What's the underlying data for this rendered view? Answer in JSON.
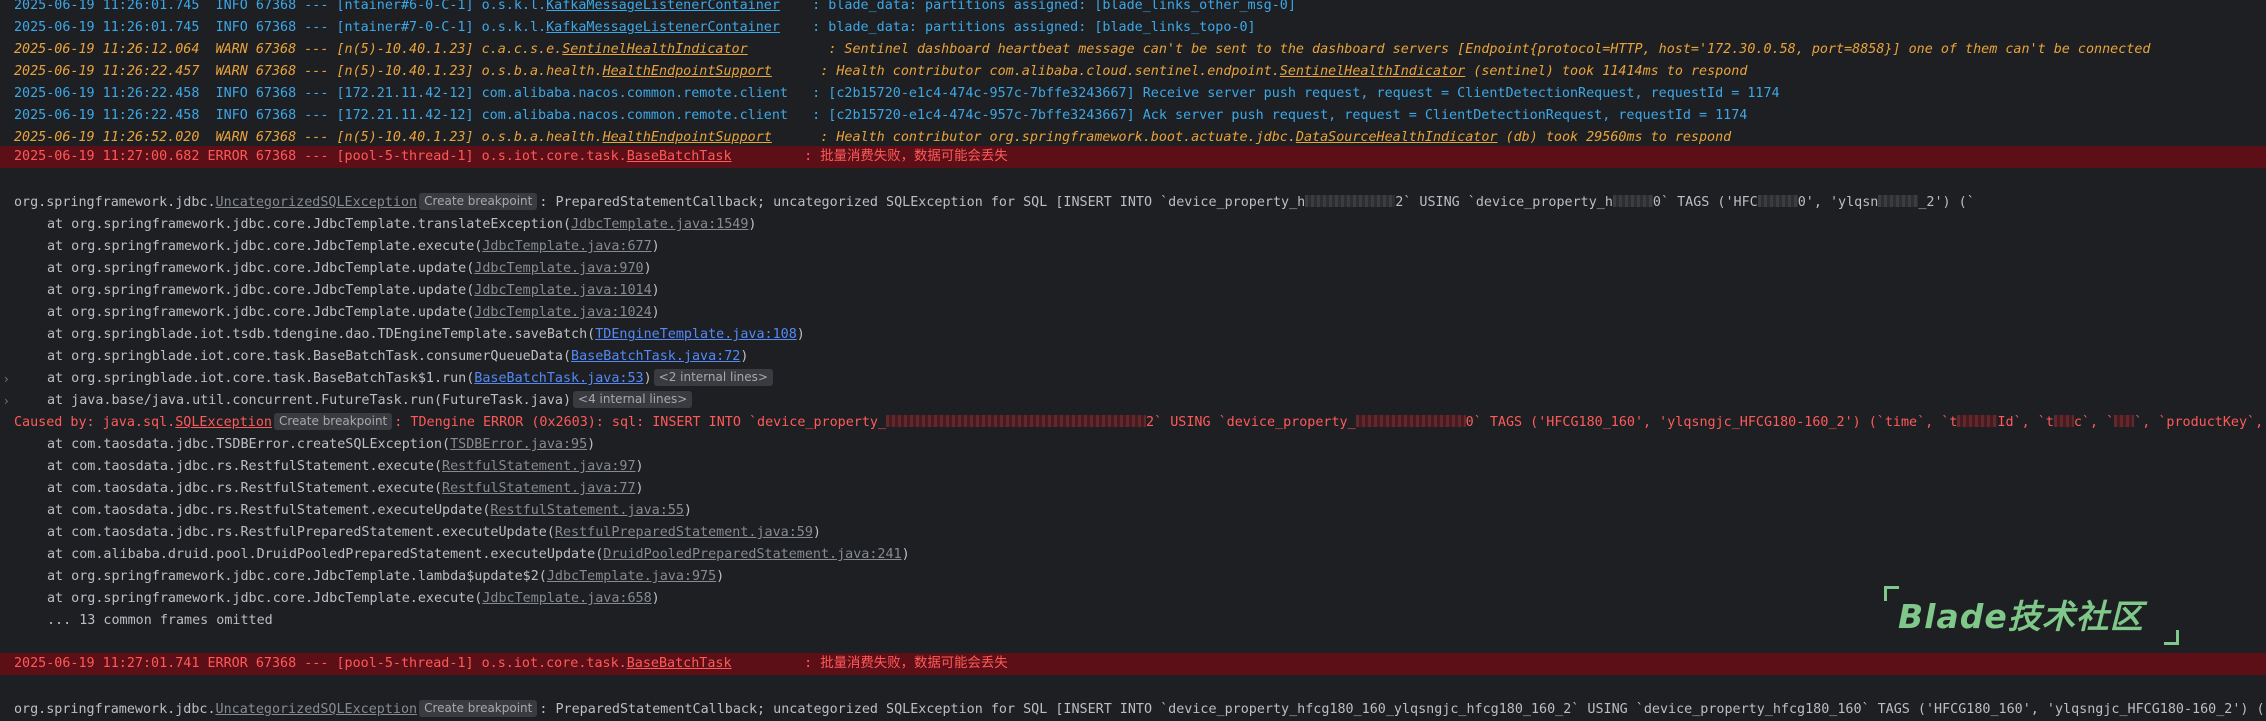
{
  "colors": {
    "background": "#1e1f22",
    "info": "#3ca8e8",
    "warn": "#e8a33c",
    "error": "#ff5a5a",
    "error_row_bg": "#5c0f16",
    "link": "#548af7",
    "watermark": "#7fc88a"
  },
  "console": {
    "chip_breakpoint": "Create breakpoint",
    "log_lines": [
      {
        "ts": "2025-06-19 11:26:01.745",
        "level": "INFO",
        "pid": "67368",
        "sep": "---",
        "thread": "[ntainer#6-0-C-1]",
        "logger_prefix": "o.s.k.l.",
        "logger_cls": "KafkaMessageListenerContainer",
        "pad": "    ",
        "msg": ": blade_data: partitions assigned: [blade_links_other_msg-0]"
      },
      {
        "ts": "2025-06-19 11:26:01.745",
        "level": "INFO",
        "pid": "67368",
        "sep": "---",
        "thread": "[ntainer#7-0-C-1]",
        "logger_prefix": "o.s.k.l.",
        "logger_cls": "KafkaMessageListenerContainer",
        "pad": "    ",
        "msg": ": blade_data: partitions assigned: [blade_links_topo-0]"
      },
      {
        "ts": "2025-06-19 11:26:12.064",
        "level": "WARN",
        "pid": "67368",
        "sep": "---",
        "thread": "[n(5)-10.40.1.23]",
        "logger_prefix": "c.a.c.s.e.",
        "logger_cls": "SentinelHealthIndicator",
        "pad": "          ",
        "msg": ": Sentinel dashboard heartbeat message can't be sent to the dashboard servers [Endpoint{protocol=HTTP, host='172.30.0.58, port=8858}] one of them can't be connected"
      },
      {
        "ts": "2025-06-19 11:26:22.457",
        "level": "WARN",
        "pid": "67368",
        "sep": "---",
        "thread": "[n(5)-10.40.1.23]",
        "logger_prefix": "o.s.b.a.health.",
        "logger_cls": "HealthEndpointSupport",
        "pad": "      ",
        "msg_pre": ": Health contributor com.alibaba.cloud.sentinel.endpoint.",
        "msg_cls": "SentinelHealthIndicator",
        "msg_post": " (sentinel) took 11414ms to respond"
      },
      {
        "ts": "2025-06-19 11:26:22.458",
        "level": "INFO",
        "pid": "67368",
        "sep": "---",
        "thread": "[172.21.11.42-12]",
        "logger_prefix": "com.alibaba.nacos.common.remote.client",
        "logger_cls": "",
        "pad": "   ",
        "msg": ": [c2b15720-e1c4-474c-957c-7bffe3243667] Receive server push request, request = ClientDetectionRequest, requestId = 1174"
      },
      {
        "ts": "2025-06-19 11:26:22.458",
        "level": "INFO",
        "pid": "67368",
        "sep": "---",
        "thread": "[172.21.11.42-12]",
        "logger_prefix": "com.alibaba.nacos.common.remote.client",
        "logger_cls": "",
        "pad": "   ",
        "msg": ": [c2b15720-e1c4-474c-957c-7bffe3243667] Ack server push request, request = ClientDetectionRequest, requestId = 1174"
      },
      {
        "ts": "2025-06-19 11:26:52.020",
        "level": "WARN",
        "pid": "67368",
        "sep": "---",
        "thread": "[n(5)-10.40.1.23]",
        "logger_prefix": "o.s.b.a.health.",
        "logger_cls": "HealthEndpointSupport",
        "pad": "      ",
        "msg_pre": ": Health contributor org.springframework.boot.actuate.jdbc.",
        "msg_cls": "DataSourceHealthIndicator",
        "msg_post": " (db) took 29560ms to respond"
      }
    ],
    "error_lines": [
      {
        "ts": "2025-06-19 11:27:00.682",
        "level": "ERROR",
        "pid": "67368",
        "sep": "---",
        "thread": "[pool-5-thread-1]",
        "logger_prefix": "o.s.iot.core.task.",
        "logger_cls": "BaseBatchTask",
        "pad": "         ",
        "msg": ": 批量消费失败，数据可能会丢失"
      },
      {
        "ts": "2025-06-19 11:27:01.741",
        "level": "ERROR",
        "pid": "67368",
        "sep": "---",
        "thread": "[pool-5-thread-1]",
        "logger_prefix": "o.s.iot.core.task.",
        "logger_cls": "BaseBatchTask",
        "pad": "         ",
        "msg": ": 批量消费失败，数据可能会丢失"
      }
    ],
    "exception1": {
      "pkg": "org.springframework.jdbc.",
      "cls": "UncategorizedSQLException",
      "msg_a": ": PreparedStatementCallback; uncategorized SQLException for SQL [INSERT INTO `device_property_h",
      "msg_b": "2` USING `device_property_h",
      "msg_c": "0` TAGS ('HFC",
      "msg_d": "0', 'ylqsn",
      "msg_e": "_2') (`"
    },
    "stack1": [
      {
        "pre": "at org.springframework.jdbc.core.JdbcTemplate.translateException(",
        "link": "JdbcTemplate.java:1549",
        "kind": "gray",
        "post": ")"
      },
      {
        "pre": "at org.springframework.jdbc.core.JdbcTemplate.execute(",
        "link": "JdbcTemplate.java:677",
        "kind": "gray",
        "post": ")"
      },
      {
        "pre": "at org.springframework.jdbc.core.JdbcTemplate.update(",
        "link": "JdbcTemplate.java:970",
        "kind": "gray",
        "post": ")"
      },
      {
        "pre": "at org.springframework.jdbc.core.JdbcTemplate.update(",
        "link": "JdbcTemplate.java:1014",
        "kind": "gray",
        "post": ")"
      },
      {
        "pre": "at org.springframework.jdbc.core.JdbcTemplate.update(",
        "link": "JdbcTemplate.java:1024",
        "kind": "gray",
        "post": ")"
      },
      {
        "pre": "at org.springblade.iot.tsdb.tdengine.dao.TDEngineTemplate.saveBatch(",
        "link": "TDEngineTemplate.java:108",
        "kind": "blue",
        "post": ")"
      },
      {
        "pre": "at org.springblade.iot.core.task.BaseBatchTask.consumerQueueData(",
        "link": "BaseBatchTask.java:72",
        "kind": "blue",
        "post": ")"
      },
      {
        "pre": "at org.springblade.iot.core.task.BaseBatchTask$1.run(",
        "link": "BaseBatchTask.java:53",
        "kind": "blue",
        "post": ")",
        "chip": "<2 internal lines>",
        "chev": true
      },
      {
        "pre": "at java.base/java.util.concurrent.FutureTask.run(FutureTask.java)",
        "link": "",
        "kind": "none",
        "post": "",
        "chip": "<4 internal lines>",
        "chev": true
      }
    ],
    "caused_by": {
      "pre": "Caused by: java.sql.",
      "cls": "SQLException",
      "msg_a": ": TDengine ERROR (0x2603): sql: INSERT INTO `device_property_",
      "msg_b": "2` USING `device_property_",
      "msg_c": "0` TAGS ('HFCG180_160', 'ylqsngjc_HFCG180-160_2') (`time`, `t",
      "msg_d": "Id`, `t",
      "msg_e": "c`, `",
      "msg_f": "`, `productKey`, `dev"
    },
    "stack2": [
      {
        "pre": "at com.taosdata.jdbc.TSDBError.createSQLException(",
        "link": "TSDBError.java:95",
        "kind": "gray",
        "post": ")"
      },
      {
        "pre": "at com.taosdata.jdbc.rs.RestfulStatement.execute(",
        "link": "RestfulStatement.java:97",
        "kind": "gray",
        "post": ")"
      },
      {
        "pre": "at com.taosdata.jdbc.rs.RestfulStatement.execute(",
        "link": "RestfulStatement.java:77",
        "kind": "gray",
        "post": ")"
      },
      {
        "pre": "at com.taosdata.jdbc.rs.RestfulStatement.executeUpdate(",
        "link": "RestfulStatement.java:55",
        "kind": "gray",
        "post": ")"
      },
      {
        "pre": "at com.taosdata.jdbc.rs.RestfulPreparedStatement.executeUpdate(",
        "link": "RestfulPreparedStatement.java:59",
        "kind": "gray",
        "post": ")"
      },
      {
        "pre": "at com.alibaba.druid.pool.DruidPooledPreparedStatement.executeUpdate(",
        "link": "DruidPooledPreparedStatement.java:241",
        "kind": "gray",
        "post": ")"
      },
      {
        "pre": "at org.springframework.jdbc.core.JdbcTemplate.lambda$update$2(",
        "link": "JdbcTemplate.java:975",
        "kind": "gray",
        "post": ")"
      },
      {
        "pre": "at org.springframework.jdbc.core.JdbcTemplate.execute(",
        "link": "JdbcTemplate.java:658",
        "kind": "gray",
        "post": ")"
      }
    ],
    "omitted": "... 13 common frames omitted",
    "exception2": {
      "pkg": "org.springframework.jdbc.",
      "cls": "UncategorizedSQLException",
      "msg": ": PreparedStatementCallback; uncategorized SQLException for SQL [INSERT INTO `device_property_hfcg180_160_ylqsngjc_hfcg180_160_2` USING `device_property_hfcg180_160` TAGS ('HFCG180_160', 'ylqsngjc_HFCG180-160_2') (`"
    }
  },
  "watermark": {
    "text": "Blade技术社区"
  }
}
